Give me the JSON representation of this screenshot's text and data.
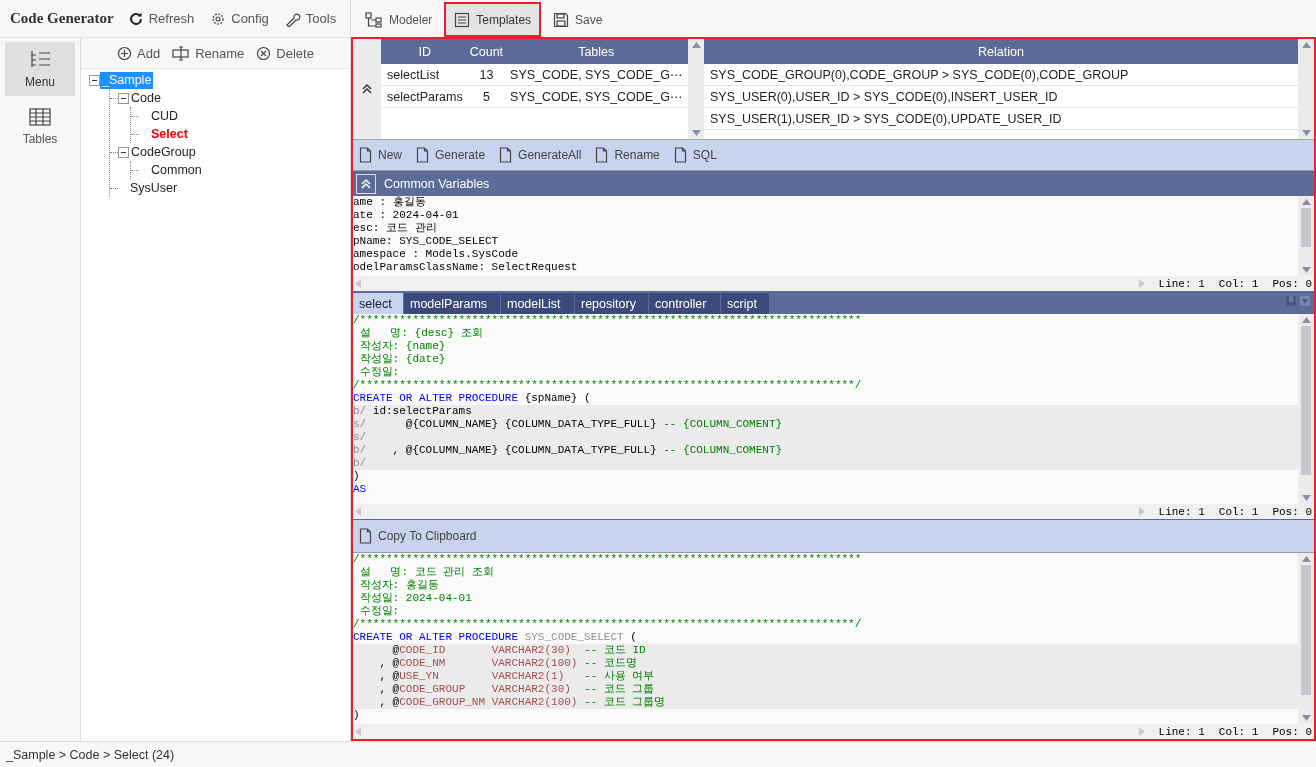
{
  "app_bar": {
    "title": "Code Generator",
    "buttons": [
      "Refresh",
      "Config",
      "Tools"
    ]
  },
  "rail": [
    {
      "label": "Menu",
      "selected": true
    },
    {
      "label": "Tables",
      "selected": false
    }
  ],
  "tree_actions": [
    "Add",
    "Rename",
    "Delete"
  ],
  "tree": [
    {
      "label": "_Sample",
      "selected": true,
      "active": false,
      "expanded": true,
      "children": [
        {
          "label": "Code",
          "selected": false,
          "active": false,
          "expanded": true,
          "children": [
            {
              "label": "CUD",
              "selected": false,
              "active": false
            },
            {
              "label": "Select",
              "selected": false,
              "active": true
            }
          ]
        },
        {
          "label": "CodeGroup",
          "selected": false,
          "active": false,
          "expanded": true,
          "children": [
            {
              "label": "Common",
              "selected": false,
              "active": false
            }
          ]
        },
        {
          "label": "SysUser",
          "selected": false,
          "active": false
        }
      ]
    }
  ],
  "status_bar": "_Sample > Code >  Select (24)",
  "top_tabs": [
    {
      "label": "Modeler",
      "selected": false
    },
    {
      "label": "Templates",
      "selected": true
    },
    {
      "label": "Save",
      "selected": false
    }
  ],
  "templates_table": {
    "columns": [
      "ID",
      "Count",
      "Tables"
    ],
    "rows": [
      [
        "selectList",
        "13",
        "SYS_CODE, SYS_CODE_G⋯"
      ],
      [
        "selectParams",
        "5",
        "SYS_CODE, SYS_CODE_G⋯"
      ]
    ]
  },
  "relation_table": {
    "columns": [
      "Relation"
    ],
    "rows": [
      [
        "SYS_CODE_GROUP(0),CODE_GROUP > SYS_CODE(0),CODE_GROUP"
      ],
      [
        "SYS_USER(0),USER_ID > SYS_CODE(0),INSERT_USER_ID"
      ],
      [
        "SYS_USER(1),USER_ID > SYS_CODE(0),UPDATE_USER_ID"
      ]
    ]
  },
  "template_toolbar": [
    "New",
    "Generate",
    "GenerateAll",
    "Rename",
    "SQL"
  ],
  "common_variables": {
    "title": "Common Variables",
    "editor": {
      "status": [
        "Line: 1",
        "Col: 1",
        "Pos: 0"
      ],
      "lines": [
        {
          "highlight": false,
          "segments": [
            {
              "kind": "plain",
              "text": "ame : 홍길동"
            }
          ]
        },
        {
          "highlight": false,
          "segments": [
            {
              "kind": "plain",
              "text": "ate : 2024-04-01"
            }
          ]
        },
        {
          "highlight": false,
          "segments": [
            {
              "kind": "plain",
              "text": "esc: 코드 관리"
            }
          ]
        },
        {
          "highlight": false,
          "segments": [
            {
              "kind": "plain",
              "text": "pName: SYS_CODE_SELECT"
            }
          ]
        },
        {
          "highlight": false,
          "segments": [
            {
              "kind": "plain",
              "text": "amespace : Models.SysCode"
            }
          ]
        },
        {
          "highlight": false,
          "segments": [
            {
              "kind": "plain",
              "text": "odelParamsClassName: SelectRequest"
            }
          ]
        }
      ]
    }
  },
  "template_tabs": [
    {
      "label": "select",
      "selected": true
    },
    {
      "label": "modelParams",
      "selected": false
    },
    {
      "label": "modelList",
      "selected": false
    },
    {
      "label": "repository",
      "selected": false
    },
    {
      "label": "controller",
      "selected": false
    },
    {
      "label": "script",
      "selected": false
    }
  ],
  "template_editor": {
    "status": [
      "Line: 1",
      "Col: 1",
      "Pos: 0"
    ],
    "lines": [
      {
        "highlight": false,
        "segments": [
          {
            "kind": "comment",
            "text": "/****************************************************************************"
          }
        ]
      },
      {
        "highlight": false,
        "segments": [
          {
            "kind": "comment",
            "text": " 설   명: {desc} 조회"
          }
        ]
      },
      {
        "highlight": false,
        "segments": [
          {
            "kind": "comment",
            "text": " 작성자: {name}"
          }
        ]
      },
      {
        "highlight": false,
        "segments": [
          {
            "kind": "comment",
            "text": " 작성일: {date}"
          }
        ]
      },
      {
        "highlight": false,
        "segments": [
          {
            "kind": "comment",
            "text": " 수정일:"
          }
        ]
      },
      {
        "highlight": false,
        "segments": [
          {
            "kind": "comment",
            "text": "/***************************************************************************/"
          }
        ]
      },
      {
        "highlight": false,
        "segments": [
          {
            "kind": "keyword",
            "text": "CREATE OR ALTER PROCEDURE"
          },
          {
            "kind": "plain",
            "text": " {spName} ("
          }
        ]
      },
      {
        "highlight": true,
        "segments": [
          {
            "kind": "muted",
            "text": "b/"
          },
          {
            "kind": "plain",
            "text": " id:selectParams"
          }
        ]
      },
      {
        "highlight": true,
        "segments": [
          {
            "kind": "muted",
            "text": "s/"
          },
          {
            "kind": "plain",
            "text": "      @{COLUMN_NAME} {COLUMN_DATA_TYPE_FULL} "
          },
          {
            "kind": "comment",
            "text": "-- {COLUMN_COMENT}"
          }
        ]
      },
      {
        "highlight": true,
        "segments": [
          {
            "kind": "muted",
            "text": "s/"
          }
        ]
      },
      {
        "highlight": true,
        "segments": [
          {
            "kind": "muted",
            "text": "b/"
          },
          {
            "kind": "plain",
            "text": "    , @{COLUMN_NAME} {COLUMN_DATA_TYPE_FULL} "
          },
          {
            "kind": "comment",
            "text": "-- {COLUMN_COMENT}"
          }
        ]
      },
      {
        "highlight": true,
        "segments": [
          {
            "kind": "muted",
            "text": "b/"
          }
        ]
      },
      {
        "highlight": false,
        "segments": [
          {
            "kind": "plain",
            "text": ")"
          }
        ]
      },
      {
        "highlight": false,
        "segments": [
          {
            "kind": "keyword",
            "text": "AS"
          }
        ]
      }
    ]
  },
  "output": {
    "button": "Copy To Clipboard",
    "editor": {
      "status": [
        "Line: 1",
        "Col: 1",
        "Pos: 0"
      ],
      "lines": [
        {
          "highlight": false,
          "segments": [
            {
              "kind": "comment",
              "text": "/****************************************************************************"
            }
          ]
        },
        {
          "highlight": false,
          "segments": [
            {
              "kind": "comment",
              "text": " 설   명: 코드 관리 조회"
            }
          ]
        },
        {
          "highlight": false,
          "segments": [
            {
              "kind": "comment",
              "text": " 작성자: 홍길동"
            }
          ]
        },
        {
          "highlight": false,
          "segments": [
            {
              "kind": "comment",
              "text": " 작성일: 2024-04-01"
            }
          ]
        },
        {
          "highlight": false,
          "segments": [
            {
              "kind": "comment",
              "text": " 수정일:"
            }
          ]
        },
        {
          "highlight": false,
          "segments": [
            {
              "kind": "comment",
              "text": "/***************************************************************************/"
            }
          ]
        },
        {
          "highlight": false,
          "segments": [
            {
              "kind": "keyword",
              "text": "CREATE OR ALTER PROCEDURE "
            },
            {
              "kind": "muted",
              "text": "SYS_CODE_SELECT"
            },
            {
              "kind": "plain",
              "text": " ("
            }
          ]
        },
        {
          "highlight": true,
          "segments": [
            {
              "kind": "plain",
              "text": "      @"
            },
            {
              "kind": "param",
              "text": "CODE_ID       VARCHAR2(30)  "
            },
            {
              "kind": "comment",
              "text": "-- 코드 ID"
            }
          ]
        },
        {
          "highlight": true,
          "segments": [
            {
              "kind": "plain",
              "text": "    , @"
            },
            {
              "kind": "param",
              "text": "CODE_NM       VARCHAR2(100) "
            },
            {
              "kind": "comment",
              "text": "-- 코드명"
            }
          ]
        },
        {
          "highlight": true,
          "segments": [
            {
              "kind": "plain",
              "text": "    , @"
            },
            {
              "kind": "param",
              "text": "USE_YN        VARCHAR2(1)   "
            },
            {
              "kind": "comment",
              "text": "-- 사용 여부"
            }
          ]
        },
        {
          "highlight": true,
          "segments": [
            {
              "kind": "plain",
              "text": "    , @"
            },
            {
              "kind": "param",
              "text": "CODE_GROUP    VARCHAR2(30)  "
            },
            {
              "kind": "comment",
              "text": "-- 코드 그룹"
            }
          ]
        },
        {
          "highlight": true,
          "segments": [
            {
              "kind": "plain",
              "text": "    , @"
            },
            {
              "kind": "param",
              "text": "CODE_GROUP_NM VARCHAR2(100) "
            },
            {
              "kind": "comment",
              "text": "-- 코드 그룹명"
            }
          ]
        },
        {
          "highlight": false,
          "segments": [
            {
              "kind": "plain",
              "text": ")"
            }
          ]
        }
      ]
    }
  }
}
